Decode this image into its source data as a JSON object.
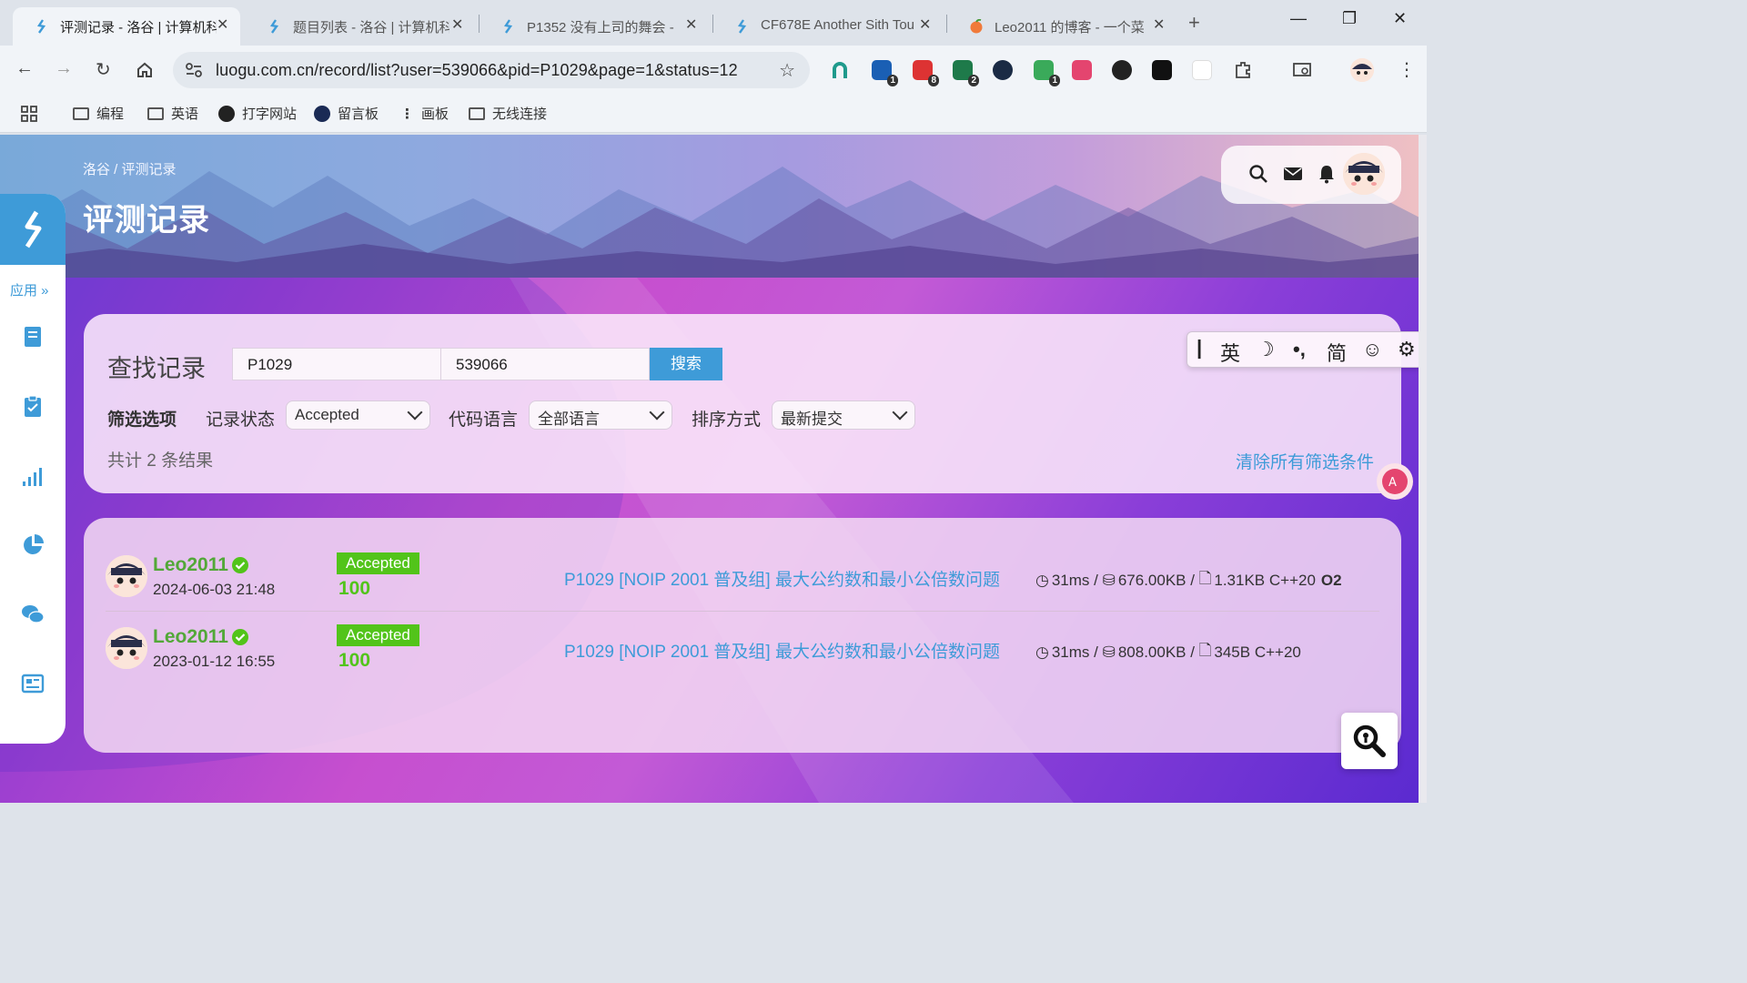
{
  "browser": {
    "tabs": [
      {
        "title": "评测记录 - 洛谷 | 计算机科",
        "active": true
      },
      {
        "title": "题目列表 - 洛谷 | 计算机科",
        "active": false
      },
      {
        "title": "P1352 没有上司的舞会 - ",
        "active": false
      },
      {
        "title": "CF678E Another Sith Tou",
        "active": false
      },
      {
        "title": "Leo2011 的博客 - 一个菜",
        "active": false
      }
    ],
    "url": "luogu.com.cn/record/list?user=539066&pid=P1029&page=1&status=12",
    "extension_badges": [
      "1",
      "8",
      "2",
      "1"
    ],
    "bookmarks": [
      "编程",
      "英语",
      "打字网站",
      "留言板",
      "画板",
      "无线连接"
    ]
  },
  "header": {
    "breadcrumb_site": "洛谷",
    "breadcrumb_sep": " / ",
    "breadcrumb_page": "评测记录",
    "title": "评测记录"
  },
  "sidebar": {
    "apps_label": "应用 »",
    "items": [
      "book-icon",
      "clipboard-check-icon",
      "bar-chart-icon",
      "pie-chart-icon",
      "chat-icon",
      "newspaper-icon"
    ]
  },
  "filter": {
    "heading": "查找记录",
    "problem_value": "P1029",
    "user_value": "539066",
    "search_label": "搜索",
    "options_label": "筛选选项",
    "status_label": "记录状态",
    "status_value": "Accepted",
    "lang_label": "代码语言",
    "lang_value": "全部语言",
    "order_label": "排序方式",
    "order_value": "最新提交",
    "count_text": "共计 2 条结果",
    "clear_label": "清除所有筛选条件"
  },
  "ime": {
    "mode": "英",
    "simplified": "简"
  },
  "records": [
    {
      "user": "Leo2011",
      "date": "2024-06-03 21:48",
      "status": "Accepted",
      "score": "100",
      "problem": "P1029 [NOIP 2001 普及组] 最大公约数和最小公倍数问题",
      "time": "31ms",
      "memory": "676.00KB",
      "code_size": "1.31KB",
      "language": "C++20",
      "o2": "O2"
    },
    {
      "user": "Leo2011",
      "date": "2023-01-12 16:55",
      "status": "Accepted",
      "score": "100",
      "problem": "P1029 [NOIP 2001 普及组] 最大公约数和最小公倍数问题",
      "time": "31ms",
      "memory": "808.00KB",
      "code_size": "345B",
      "language": "C++20",
      "o2": ""
    }
  ],
  "colors": {
    "accent": "#3e9bd8",
    "accepted": "#52c41a",
    "username": "#52a838"
  }
}
